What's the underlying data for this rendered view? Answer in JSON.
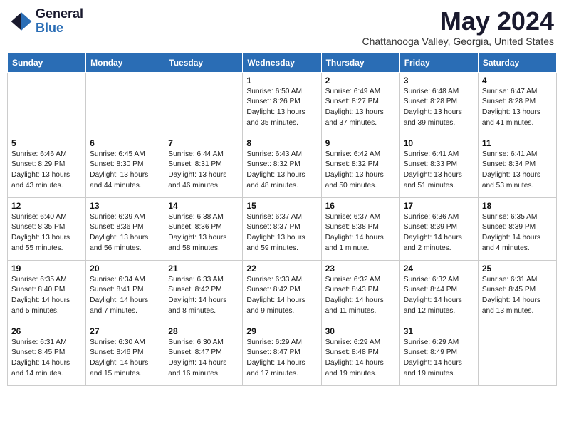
{
  "header": {
    "logo_general": "General",
    "logo_blue": "Blue",
    "month_title": "May 2024",
    "location": "Chattanooga Valley, Georgia, United States"
  },
  "days_of_week": [
    "Sunday",
    "Monday",
    "Tuesday",
    "Wednesday",
    "Thursday",
    "Friday",
    "Saturday"
  ],
  "weeks": [
    [
      {
        "day": "",
        "info": ""
      },
      {
        "day": "",
        "info": ""
      },
      {
        "day": "",
        "info": ""
      },
      {
        "day": "1",
        "info": "Sunrise: 6:50 AM\nSunset: 8:26 PM\nDaylight: 13 hours\nand 35 minutes."
      },
      {
        "day": "2",
        "info": "Sunrise: 6:49 AM\nSunset: 8:27 PM\nDaylight: 13 hours\nand 37 minutes."
      },
      {
        "day": "3",
        "info": "Sunrise: 6:48 AM\nSunset: 8:28 PM\nDaylight: 13 hours\nand 39 minutes."
      },
      {
        "day": "4",
        "info": "Sunrise: 6:47 AM\nSunset: 8:28 PM\nDaylight: 13 hours\nand 41 minutes."
      }
    ],
    [
      {
        "day": "5",
        "info": "Sunrise: 6:46 AM\nSunset: 8:29 PM\nDaylight: 13 hours\nand 43 minutes."
      },
      {
        "day": "6",
        "info": "Sunrise: 6:45 AM\nSunset: 8:30 PM\nDaylight: 13 hours\nand 44 minutes."
      },
      {
        "day": "7",
        "info": "Sunrise: 6:44 AM\nSunset: 8:31 PM\nDaylight: 13 hours\nand 46 minutes."
      },
      {
        "day": "8",
        "info": "Sunrise: 6:43 AM\nSunset: 8:32 PM\nDaylight: 13 hours\nand 48 minutes."
      },
      {
        "day": "9",
        "info": "Sunrise: 6:42 AM\nSunset: 8:32 PM\nDaylight: 13 hours\nand 50 minutes."
      },
      {
        "day": "10",
        "info": "Sunrise: 6:41 AM\nSunset: 8:33 PM\nDaylight: 13 hours\nand 51 minutes."
      },
      {
        "day": "11",
        "info": "Sunrise: 6:41 AM\nSunset: 8:34 PM\nDaylight: 13 hours\nand 53 minutes."
      }
    ],
    [
      {
        "day": "12",
        "info": "Sunrise: 6:40 AM\nSunset: 8:35 PM\nDaylight: 13 hours\nand 55 minutes."
      },
      {
        "day": "13",
        "info": "Sunrise: 6:39 AM\nSunset: 8:36 PM\nDaylight: 13 hours\nand 56 minutes."
      },
      {
        "day": "14",
        "info": "Sunrise: 6:38 AM\nSunset: 8:36 PM\nDaylight: 13 hours\nand 58 minutes."
      },
      {
        "day": "15",
        "info": "Sunrise: 6:37 AM\nSunset: 8:37 PM\nDaylight: 13 hours\nand 59 minutes."
      },
      {
        "day": "16",
        "info": "Sunrise: 6:37 AM\nSunset: 8:38 PM\nDaylight: 14 hours\nand 1 minute."
      },
      {
        "day": "17",
        "info": "Sunrise: 6:36 AM\nSunset: 8:39 PM\nDaylight: 14 hours\nand 2 minutes."
      },
      {
        "day": "18",
        "info": "Sunrise: 6:35 AM\nSunset: 8:39 PM\nDaylight: 14 hours\nand 4 minutes."
      }
    ],
    [
      {
        "day": "19",
        "info": "Sunrise: 6:35 AM\nSunset: 8:40 PM\nDaylight: 14 hours\nand 5 minutes."
      },
      {
        "day": "20",
        "info": "Sunrise: 6:34 AM\nSunset: 8:41 PM\nDaylight: 14 hours\nand 7 minutes."
      },
      {
        "day": "21",
        "info": "Sunrise: 6:33 AM\nSunset: 8:42 PM\nDaylight: 14 hours\nand 8 minutes."
      },
      {
        "day": "22",
        "info": "Sunrise: 6:33 AM\nSunset: 8:42 PM\nDaylight: 14 hours\nand 9 minutes."
      },
      {
        "day": "23",
        "info": "Sunrise: 6:32 AM\nSunset: 8:43 PM\nDaylight: 14 hours\nand 11 minutes."
      },
      {
        "day": "24",
        "info": "Sunrise: 6:32 AM\nSunset: 8:44 PM\nDaylight: 14 hours\nand 12 minutes."
      },
      {
        "day": "25",
        "info": "Sunrise: 6:31 AM\nSunset: 8:45 PM\nDaylight: 14 hours\nand 13 minutes."
      }
    ],
    [
      {
        "day": "26",
        "info": "Sunrise: 6:31 AM\nSunset: 8:45 PM\nDaylight: 14 hours\nand 14 minutes."
      },
      {
        "day": "27",
        "info": "Sunrise: 6:30 AM\nSunset: 8:46 PM\nDaylight: 14 hours\nand 15 minutes."
      },
      {
        "day": "28",
        "info": "Sunrise: 6:30 AM\nSunset: 8:47 PM\nDaylight: 14 hours\nand 16 minutes."
      },
      {
        "day": "29",
        "info": "Sunrise: 6:29 AM\nSunset: 8:47 PM\nDaylight: 14 hours\nand 17 minutes."
      },
      {
        "day": "30",
        "info": "Sunrise: 6:29 AM\nSunset: 8:48 PM\nDaylight: 14 hours\nand 19 minutes."
      },
      {
        "day": "31",
        "info": "Sunrise: 6:29 AM\nSunset: 8:49 PM\nDaylight: 14 hours\nand 19 minutes."
      },
      {
        "day": "",
        "info": ""
      }
    ]
  ]
}
